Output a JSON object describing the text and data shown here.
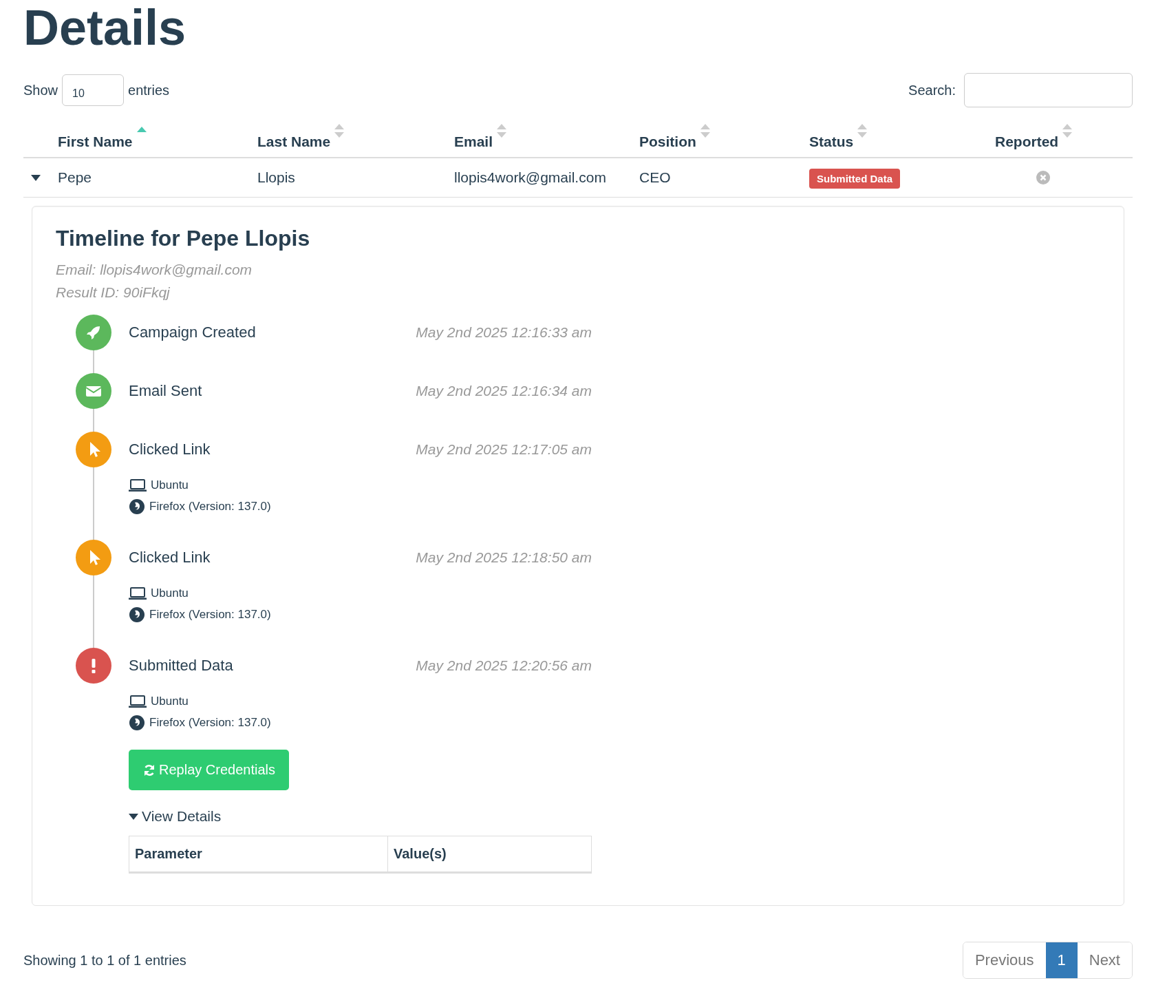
{
  "page_title": "Details",
  "length_control": {
    "label_before": "Show",
    "value": "10",
    "label_after": "entries"
  },
  "search": {
    "label": "Search:"
  },
  "table": {
    "columns": [
      {
        "label": "First Name",
        "sorted": true
      },
      {
        "label": "Last Name",
        "sorted": false
      },
      {
        "label": "Email",
        "sorted": false
      },
      {
        "label": "Position",
        "sorted": false
      },
      {
        "label": "Status",
        "sorted": false
      },
      {
        "label": "Reported",
        "sorted": false
      }
    ],
    "rows": [
      {
        "expanded": true,
        "first_name": "Pepe",
        "last_name": "Llopis",
        "email": "llopis4work@gmail.com",
        "position": "CEO",
        "status": "Submitted Data",
        "reported": false
      }
    ]
  },
  "timeline": {
    "title": "Timeline for Pepe Llopis",
    "email": "Email: llopis4work@gmail.com",
    "result_id": "Result ID: 90iFkqj",
    "events": [
      {
        "kind": "created",
        "title": "Campaign Created",
        "time": "May 2nd 2025 12:16:33 am"
      },
      {
        "kind": "sent",
        "title": "Email Sent",
        "time": "May 2nd 2025 12:16:34 am"
      },
      {
        "kind": "clicked",
        "title": "Clicked Link",
        "time": "May 2nd 2025 12:17:05 am",
        "os": "Ubuntu",
        "browser": "Firefox (Version: 137.0)"
      },
      {
        "kind": "clicked",
        "title": "Clicked Link",
        "time": "May 2nd 2025 12:18:50 am",
        "os": "Ubuntu",
        "browser": "Firefox (Version: 137.0)"
      },
      {
        "kind": "submitted",
        "title": "Submitted Data",
        "time": "May 2nd 2025 12:20:56 am",
        "os": "Ubuntu",
        "browser": "Firefox (Version: 137.0)",
        "replay_button": "Replay Credentials",
        "view_details": {
          "label": "View Details",
          "expanded": true,
          "columns": [
            "Parameter",
            "Value(s)"
          ]
        }
      }
    ]
  },
  "footer": {
    "info": "Showing 1 to 1 of 1 entries",
    "pagination": [
      {
        "label": "Previous",
        "selected": false
      },
      {
        "label": "1",
        "selected": true
      },
      {
        "label": "Next",
        "selected": false
      }
    ]
  }
}
